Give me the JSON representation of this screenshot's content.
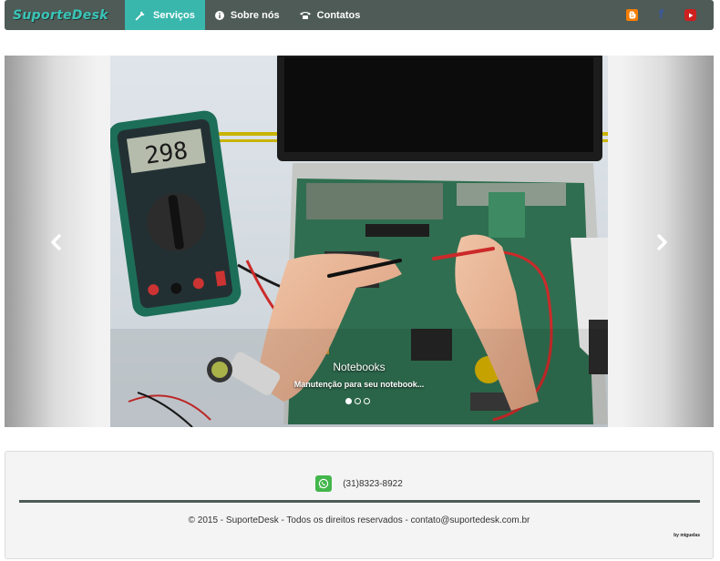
{
  "brand": {
    "name": "SuporteDesk"
  },
  "nav": {
    "items": [
      {
        "label": "Serviços",
        "icon": "wrench-icon",
        "active": true
      },
      {
        "label": "Sobre nós",
        "icon": "info-icon",
        "active": false
      },
      {
        "label": "Contatos",
        "icon": "phone-icon",
        "active": false
      }
    ],
    "social": [
      {
        "icon": "blogger-icon",
        "color": "#f57d00"
      },
      {
        "icon": "facebook-icon",
        "color": "#3b5998"
      },
      {
        "icon": "youtube-icon",
        "color": "#cd201f"
      }
    ]
  },
  "carousel": {
    "caption_title": "Notebooks",
    "caption_text": "Manutenção para seu notebook...",
    "slide_count": 3,
    "active_index": 0
  },
  "footer": {
    "phone": "(31)8323-8922",
    "copyright": "© 2015 - SuporteDesk - Todos os direitos reservados - contato@suportedesk.com.br",
    "credit": "by miguelas"
  },
  "colors": {
    "navbar": "#4e5b57",
    "accent": "#39b7ad",
    "whatsapp": "#43b64c"
  }
}
